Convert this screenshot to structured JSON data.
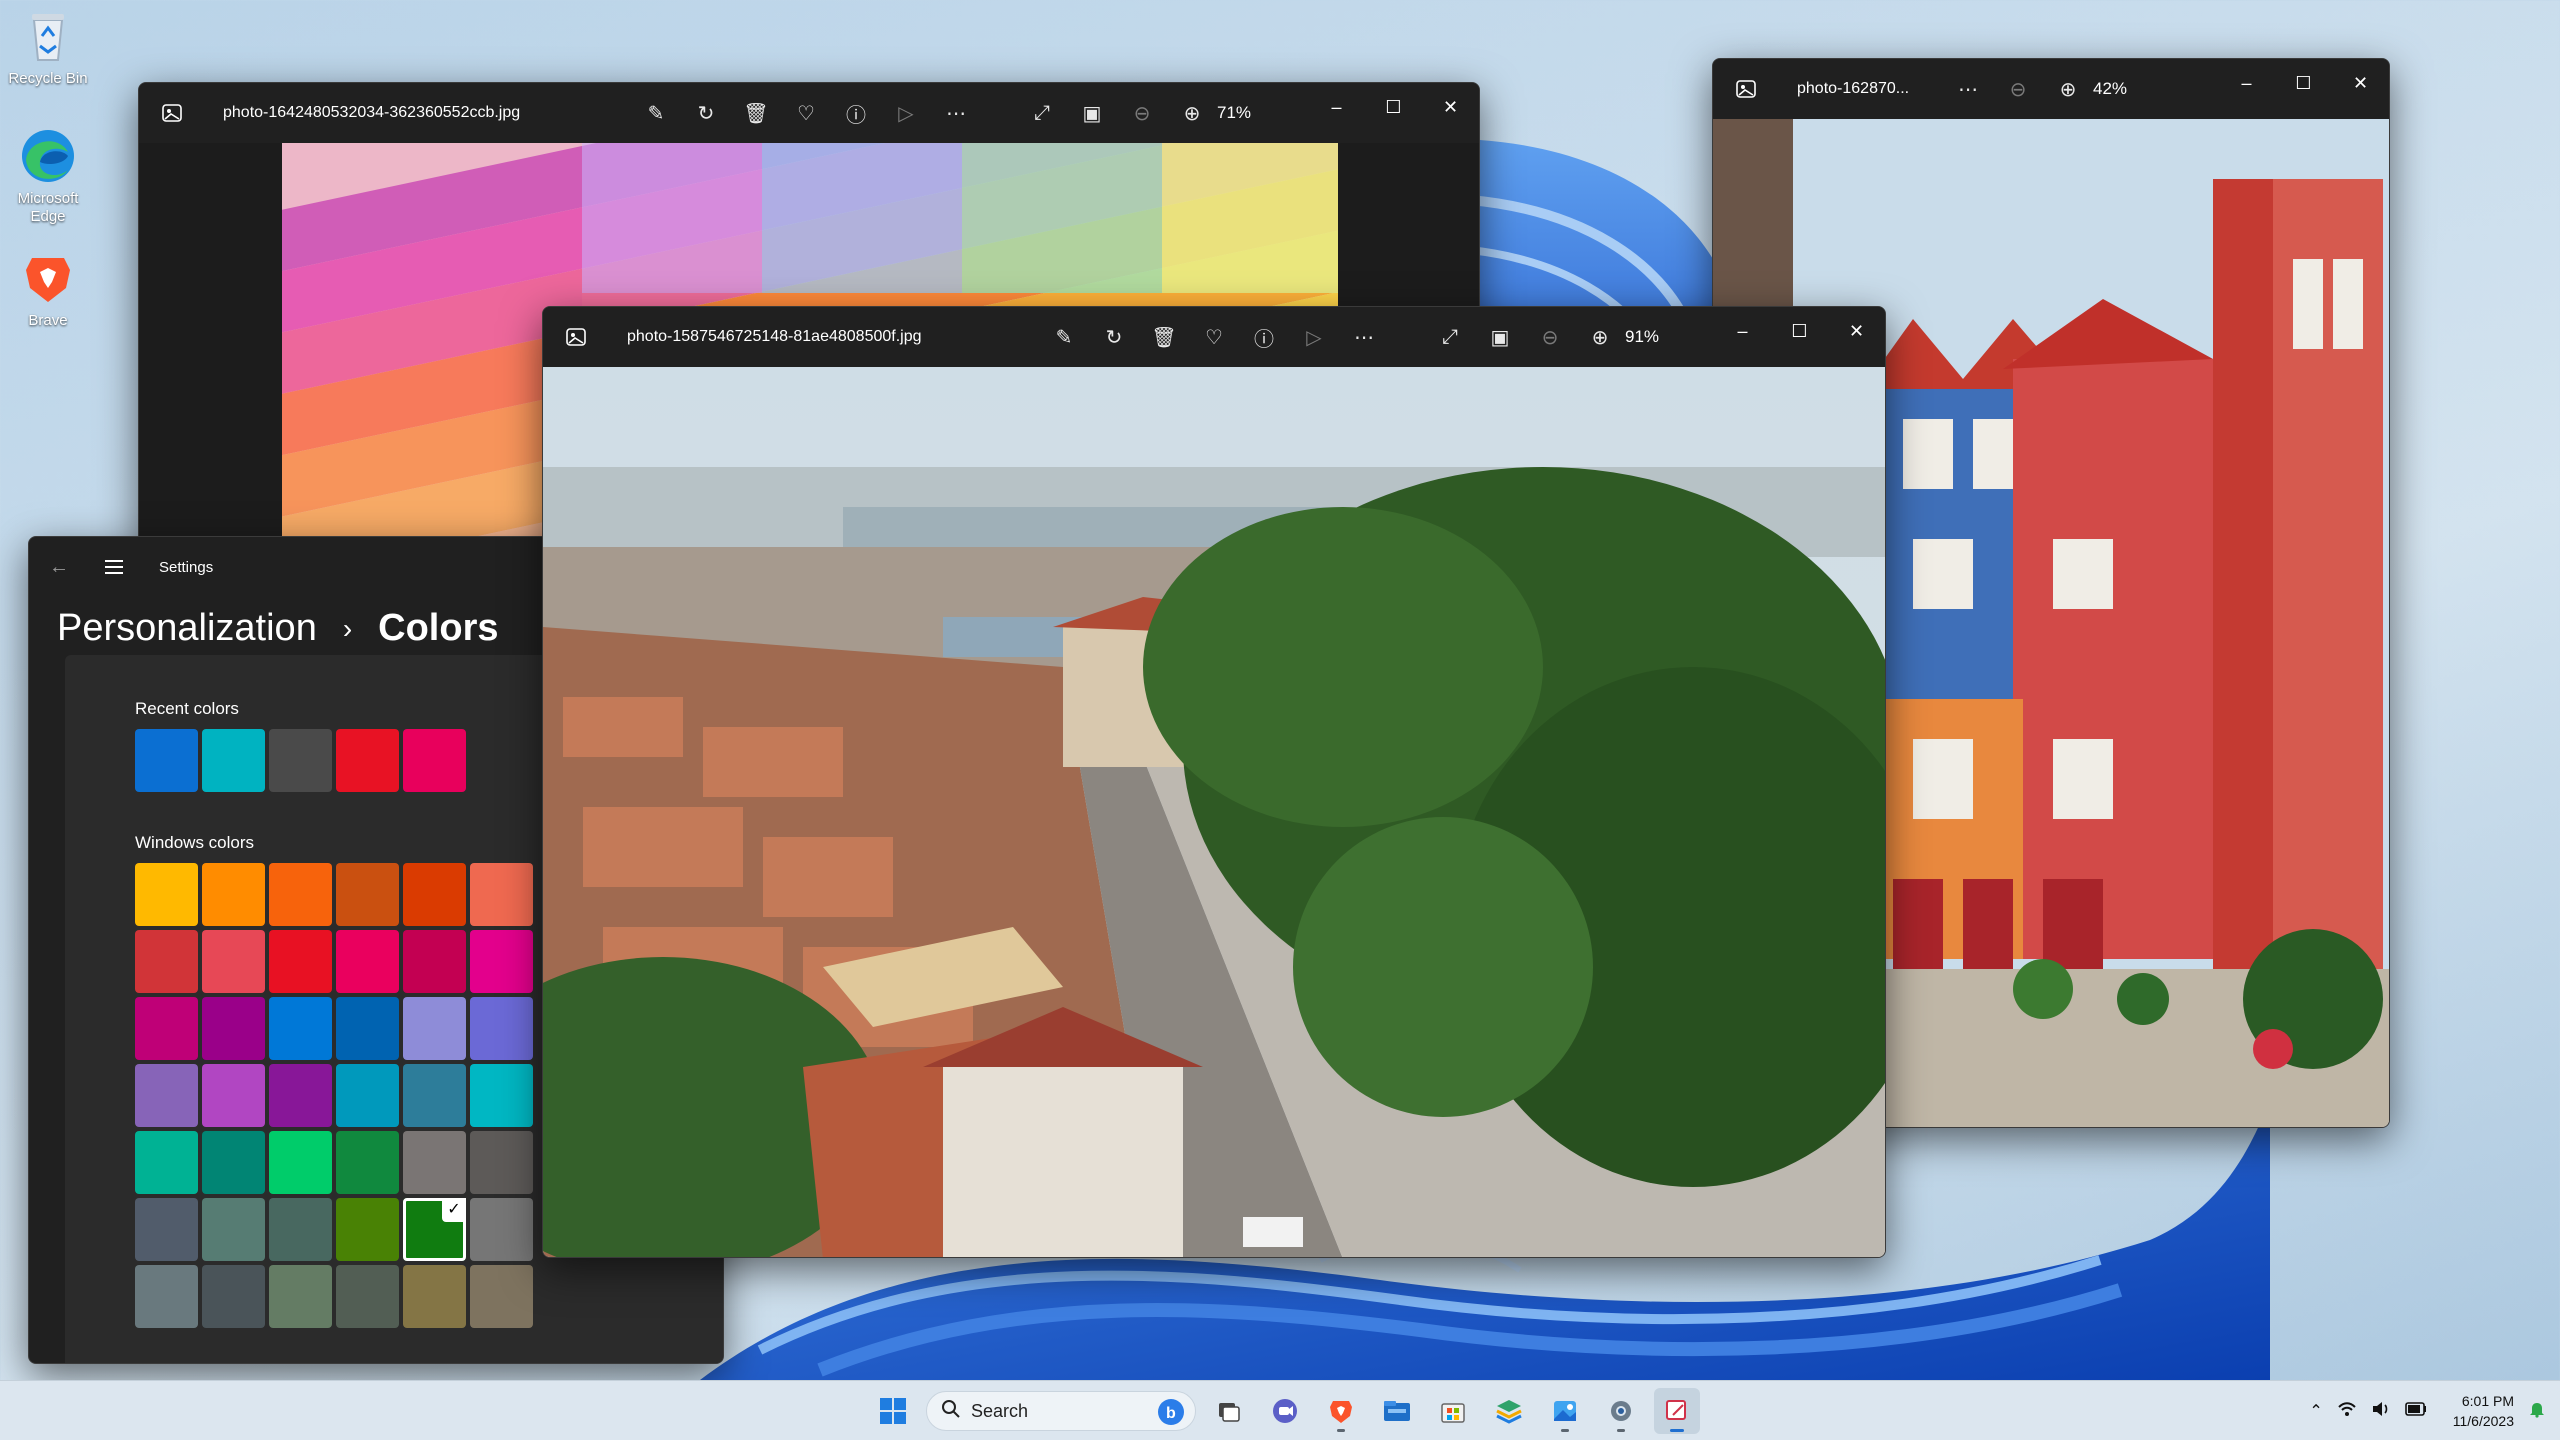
{
  "desktop": {
    "icons": [
      {
        "label": "Recycle Bin",
        "icon": "recycle-bin-icon"
      },
      {
        "label": "Microsoft Edge",
        "icon": "edge-icon"
      },
      {
        "label": "Brave",
        "icon": "brave-icon"
      }
    ]
  },
  "photo_windows": [
    {
      "title": "photo-1642480532034-362360552ccb.jpg",
      "zoom": "71%"
    },
    {
      "title": "photo-162870...",
      "zoom": "42%"
    },
    {
      "title": "photo-1587546725148-81ae4808500f.jpg",
      "zoom": "91%"
    }
  ],
  "settings": {
    "app_title": "Settings",
    "breadcrumb_parent": "Personalization",
    "breadcrumb_separator": "›",
    "breadcrumb_current": "Colors",
    "recent_label": "Recent colors",
    "recent_colors": [
      "#0b6fd2",
      "#00b3c1",
      "#4a4a4a",
      "#e81224",
      "#e8005c"
    ],
    "windows_label": "Windows colors",
    "windows_colors": [
      "#ffb900",
      "#ff8c00",
      "#f7630c",
      "#ca5010",
      "#da3b01",
      "#ef6950",
      "#d13438",
      "#e74856",
      "#e81123",
      "#ea005e",
      "#c30052",
      "#e3008c",
      "#bf0077",
      "#9a0089",
      "#0078d7",
      "#0063b1",
      "#8e8cd8",
      "#6b69d6",
      "#8764b8",
      "#b146c2",
      "#881798",
      "#0099bc",
      "#2d7d9a",
      "#00b7c3",
      "#00b294",
      "#018574",
      "#00cc6a",
      "#10893e",
      "#7a7574",
      "#5d5a58",
      "#515c6b",
      "#567c73",
      "#486860",
      "#498205",
      "#107c10",
      "#767676",
      "#69797e",
      "#4a5459",
      "#647c64",
      "#525e54",
      "#847545",
      "#7e735f"
    ],
    "selected_index": 34,
    "selected_check": "✓"
  },
  "taskbar": {
    "search_placeholder": "Search",
    "time": "6:01 PM",
    "date": "11/6/2023"
  }
}
